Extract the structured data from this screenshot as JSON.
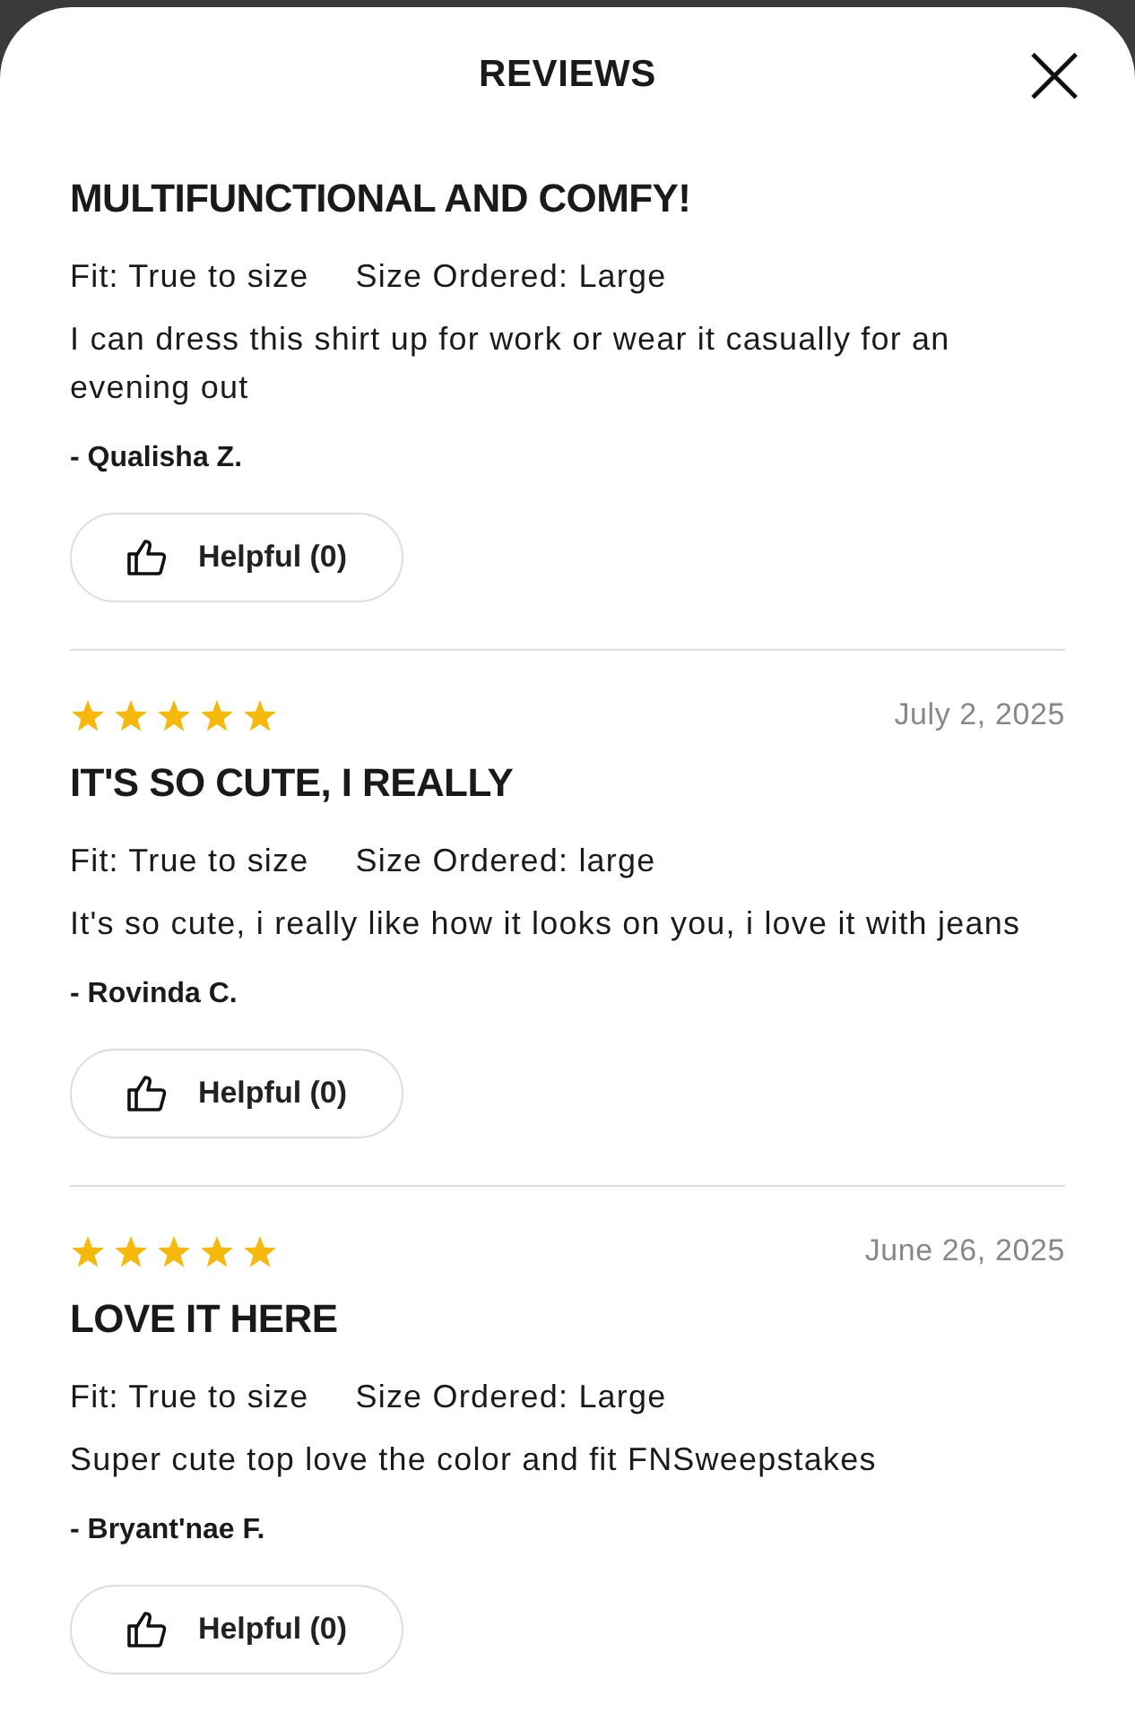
{
  "header": {
    "title": "REVIEWS",
    "close": "×"
  },
  "reviews": [
    {
      "title": "MULTIFUNCTIONAL AND COMFY!",
      "fit": "Fit: True to size",
      "size": "Size Ordered: Large",
      "body": "I can dress this shirt up for work or wear it casually for an evening out",
      "author": "- Qualisha Z.",
      "helpful": "Helpful (0)"
    },
    {
      "stars": 5,
      "date": "July 2, 2025",
      "title": "IT'S SO CUTE, I REALLY",
      "fit": "Fit: True to size",
      "size": "Size Ordered: large",
      "body": "It's so cute, i really like how it looks on you, i love it with jeans",
      "author": "- Rovinda C.",
      "helpful": "Helpful (0)"
    },
    {
      "stars": 5,
      "date": "June 26, 2025",
      "title": "LOVE IT HERE",
      "fit": "Fit: True to size",
      "size": "Size Ordered: Large",
      "body": "Super cute top love the color and fit FNSweepstakes",
      "author": "- Bryant'nae F.",
      "helpful": "Helpful (0)"
    }
  ]
}
